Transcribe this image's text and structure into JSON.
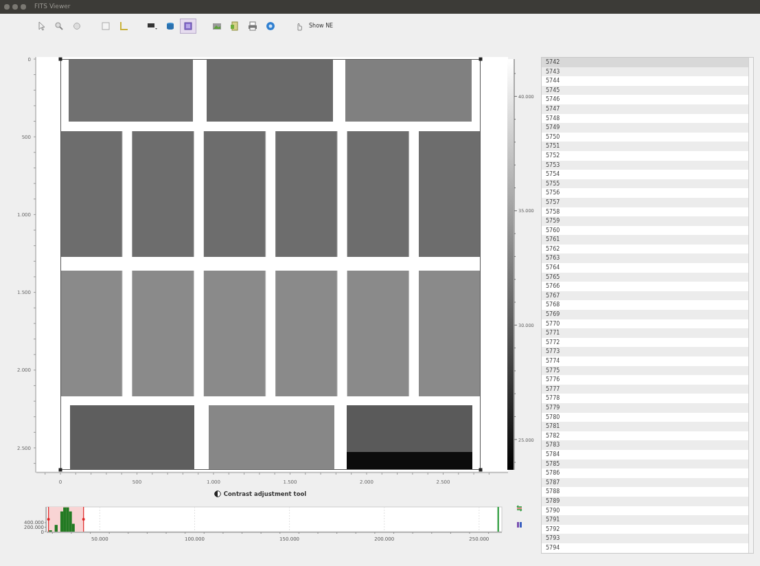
{
  "window": {
    "title": "FITS Viewer"
  },
  "toolbar": [
    {
      "selected": false
    },
    {
      "selected": false
    },
    {
      "selected": false
    },
    {
      "selected": false
    },
    {
      "selected": false
    },
    {
      "selected": false
    },
    {
      "selected": false
    },
    {
      "selected": true
    },
    {
      "selected": false
    },
    {
      "selected": false
    },
    {
      "selected": false
    },
    {
      "selected": false
    },
    {
      "selected": false,
      "label": "Show NE"
    }
  ],
  "image_view": {
    "kind": "picture",
    "x_ticks": [
      "0",
      "500",
      "1.000",
      "1.500",
      "2.000",
      "2.500"
    ],
    "y_ticks": [
      "0",
      "500",
      "1.000",
      "1.500",
      "2.000",
      "2.500"
    ],
    "colorbar_ticks": [
      "40.000",
      "35.000",
      "30.000",
      "25.000"
    ]
  },
  "contrast_tool": {
    "title": "Contrast adjustment tool",
    "chart_data": {
      "type": "bar",
      "x": [
        24000,
        27000,
        30000,
        31500,
        33000,
        34500,
        36000
      ],
      "values": [
        60000,
        300000,
        900000,
        1080000,
        1080000,
        900000,
        350000
      ],
      "xlim": [
        22000,
        262000
      ],
      "ylim": [
        0,
        1100000
      ],
      "xticks": [
        {
          "value": 50000,
          "label": "50.000"
        },
        {
          "value": 100000,
          "label": "100.000"
        },
        {
          "value": 150000,
          "label": "150.000"
        },
        {
          "value": 200000,
          "label": "200.000"
        },
        {
          "value": 250000,
          "label": "250.000"
        }
      ],
      "yticks": [
        {
          "value": 0,
          "label": "0"
        },
        {
          "value": 200000,
          "label": "200.000"
        },
        {
          "value": 400000,
          "label": "400.000"
        }
      ],
      "grid": true
    },
    "range_start": {
      "level": 0.004
    },
    "range_end": {
      "level": 0.081
    },
    "max_marker": {
      "level": 0.992
    }
  },
  "list": {
    "items": [
      {
        "label": "5742",
        "selected": true
      },
      {
        "label": "5743",
        "selected": false
      },
      {
        "label": "5744",
        "selected": false
      },
      {
        "label": "5745",
        "selected": false
      },
      {
        "label": "5746",
        "selected": false
      },
      {
        "label": "5747",
        "selected": false
      },
      {
        "label": "5748",
        "selected": false
      },
      {
        "label": "5749",
        "selected": false
      },
      {
        "label": "5750",
        "selected": false
      },
      {
        "label": "5751",
        "selected": false
      },
      {
        "label": "5752",
        "selected": false
      },
      {
        "label": "5753",
        "selected": false
      },
      {
        "label": "5754",
        "selected": false
      },
      {
        "label": "5755",
        "selected": false
      },
      {
        "label": "5756",
        "selected": false
      },
      {
        "label": "5757",
        "selected": false
      },
      {
        "label": "5758",
        "selected": false
      },
      {
        "label": "5759",
        "selected": false
      },
      {
        "label": "5760",
        "selected": false
      },
      {
        "label": "5761",
        "selected": false
      },
      {
        "label": "5762",
        "selected": false
      },
      {
        "label": "5763",
        "selected": false
      },
      {
        "label": "5764",
        "selected": false
      },
      {
        "label": "5765",
        "selected": false
      },
      {
        "label": "5766",
        "selected": false
      },
      {
        "label": "5767",
        "selected": false
      },
      {
        "label": "5768",
        "selected": false
      },
      {
        "label": "5769",
        "selected": false
      },
      {
        "label": "5770",
        "selected": false
      },
      {
        "label": "5771",
        "selected": false
      },
      {
        "label": "5772",
        "selected": false
      },
      {
        "label": "5773",
        "selected": false
      },
      {
        "label": "5774",
        "selected": false
      },
      {
        "label": "5775",
        "selected": false
      },
      {
        "label": "5776",
        "selected": false
      },
      {
        "label": "5777",
        "selected": false
      },
      {
        "label": "5778",
        "selected": false
      },
      {
        "label": "5779",
        "selected": false
      },
      {
        "label": "5780",
        "selected": false
      },
      {
        "label": "5781",
        "selected": false
      },
      {
        "label": "5782",
        "selected": false
      },
      {
        "label": "5783",
        "selected": false
      },
      {
        "label": "5784",
        "selected": false
      },
      {
        "label": "5785",
        "selected": false
      },
      {
        "label": "5786",
        "selected": false
      },
      {
        "label": "5787",
        "selected": false
      },
      {
        "label": "5788",
        "selected": false
      },
      {
        "label": "5789",
        "selected": false
      },
      {
        "label": "5790",
        "selected": false
      },
      {
        "label": "5791",
        "selected": false
      },
      {
        "label": "5792",
        "selected": false
      },
      {
        "label": "5793",
        "selected": false
      },
      {
        "label": "5794",
        "selected": false
      }
    ]
  }
}
